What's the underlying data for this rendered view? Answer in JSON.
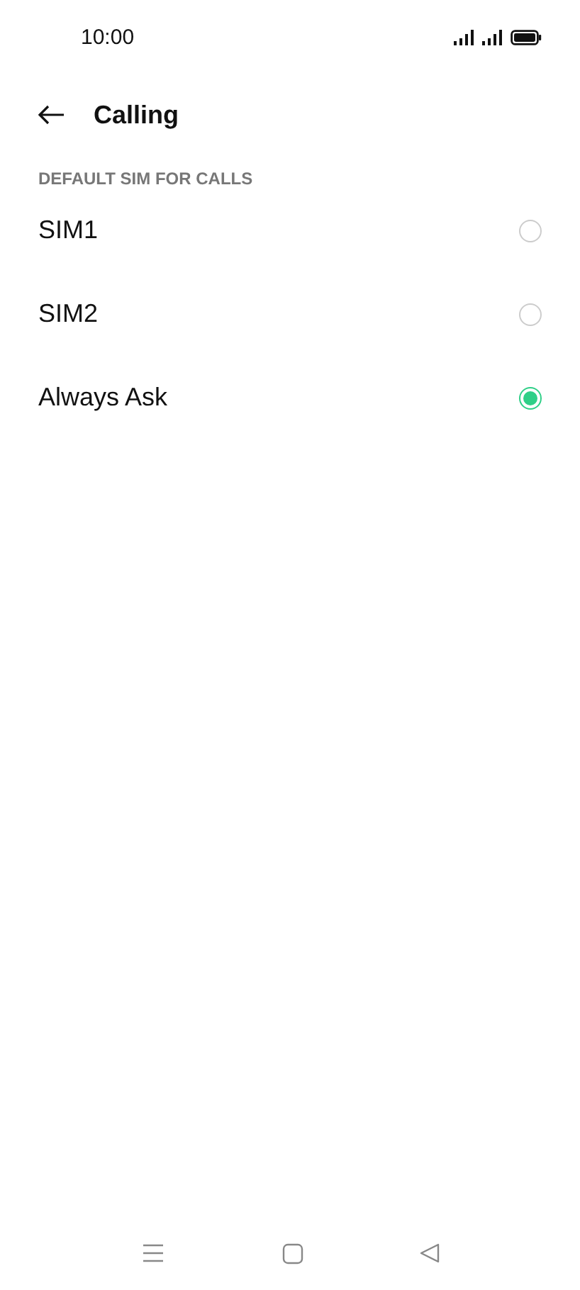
{
  "status_bar": {
    "time": "10:00"
  },
  "header": {
    "title": "Calling"
  },
  "section": {
    "heading": "DEFAULT SIM FOR CALLS"
  },
  "options": [
    {
      "label": "SIM1",
      "selected": false
    },
    {
      "label": "SIM2",
      "selected": false
    },
    {
      "label": "Always Ask",
      "selected": true
    }
  ]
}
